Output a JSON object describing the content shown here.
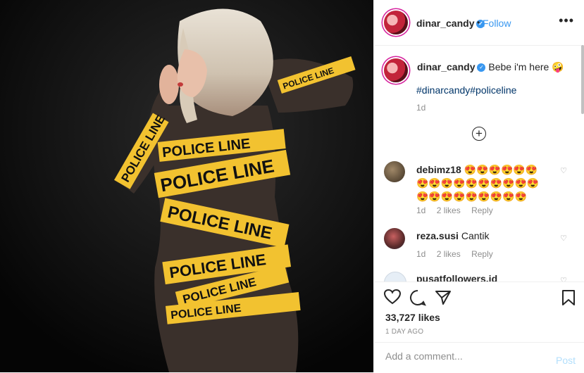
{
  "post": {
    "username": "dinar_candy",
    "follow_label": "Follow",
    "separator": "•",
    "more_label": "•••",
    "caption": "Bebe i'm here 🤪",
    "hashtags": "#dinarcandy#policeline",
    "caption_time": "1d",
    "load_more": "+",
    "photo_tape_text": "POLICE LINE"
  },
  "comments": [
    {
      "username": "debimz18",
      "text": "😍😍😍😍😍😍😍😍😍😍😍😍😍😍😍😍😍😍😍😍😍😍😍😍😍",
      "time": "1d",
      "likes": "2 likes",
      "reply": "Reply"
    },
    {
      "username": "reza.susi",
      "text": "Cantik",
      "time": "1d",
      "likes": "2 likes",
      "reply": "Reply"
    },
    {
      "username": "pusatfollowers.id",
      "text": ""
    }
  ],
  "actions": {
    "likes": "33,727 likes",
    "date": "1 DAY AGO"
  },
  "add_comment": {
    "placeholder": "Add a comment...",
    "post_label": "Post"
  },
  "colors": {
    "accent": "#3897f0",
    "tape": "#f2c230",
    "background": "#0a0a0a"
  }
}
